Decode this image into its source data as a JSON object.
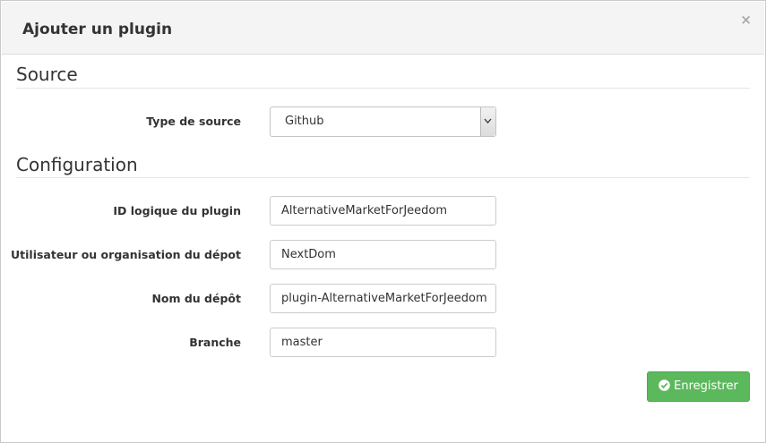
{
  "modal": {
    "title": "Ajouter un plugin",
    "close_label": "×"
  },
  "source_section": {
    "title": "Source",
    "type_label": "Type de source",
    "type_value": "Github"
  },
  "config_section": {
    "title": "Configuration",
    "fields": [
      {
        "label": "ID logique du plugin",
        "value": "AlternativeMarketForJeedom"
      },
      {
        "label": "Utilisateur ou organisation du dépot",
        "value": "NextDom"
      },
      {
        "label": "Nom du dépôt",
        "value": "plugin-AlternativeMarketForJeedom"
      },
      {
        "label": "Branche",
        "value": "master"
      }
    ]
  },
  "actions": {
    "save_label": "Enregistrer",
    "save_icon": "check-circle-icon"
  },
  "colors": {
    "header_bg": "#f4f4f4",
    "save_button": "#5cb85c",
    "text": "#333333"
  }
}
